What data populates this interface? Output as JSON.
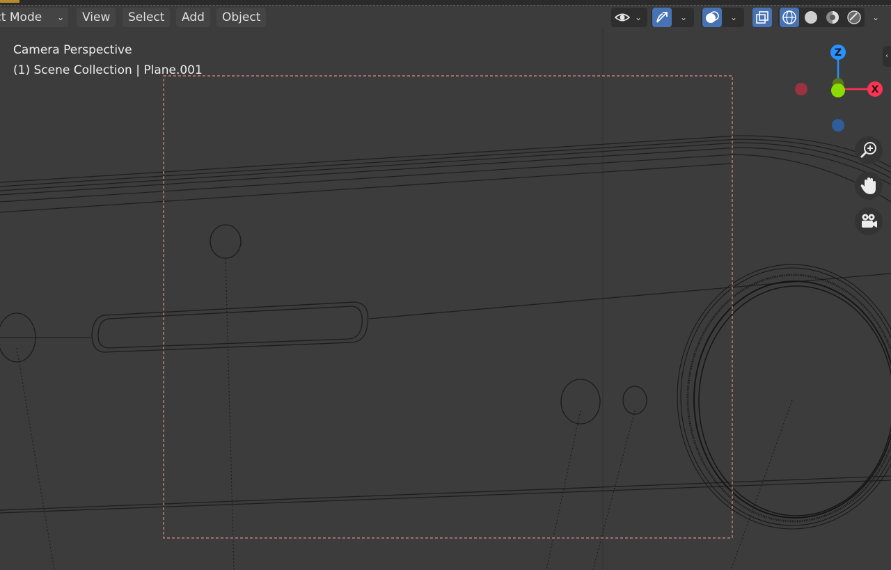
{
  "header": {
    "mode_label": "ect Mode",
    "menus": [
      "View",
      "Select",
      "Add",
      "Object"
    ]
  },
  "overlay": {
    "view_name": "Camera Perspective",
    "collection_info": "(1) Scene Collection | Plane.001"
  },
  "gizmo": {
    "z_label": "Z",
    "x_label": "X",
    "colors": {
      "x": "#ff3352",
      "y": "#8bdc00",
      "z": "#2890ff",
      "neg_x": "#9b3240",
      "neg_z": "#2f5e9c"
    }
  },
  "icons": {
    "visibility": "eye-icon",
    "gizmo_toggle": "gizmo-icon",
    "overlays": "overlays-icon",
    "xray": "xray-icon",
    "wireframe": "wireframe-shading-icon",
    "solid": "solid-shading-icon",
    "material": "material-shading-icon",
    "rendered": "rendered-shading-icon",
    "zoom": "zoom-icon",
    "pan": "hand-icon",
    "camera": "camera-icon"
  },
  "colors": {
    "background": "#3c3c3c",
    "accent": "#4772b3",
    "camera_frame": "#e08a8a"
  }
}
